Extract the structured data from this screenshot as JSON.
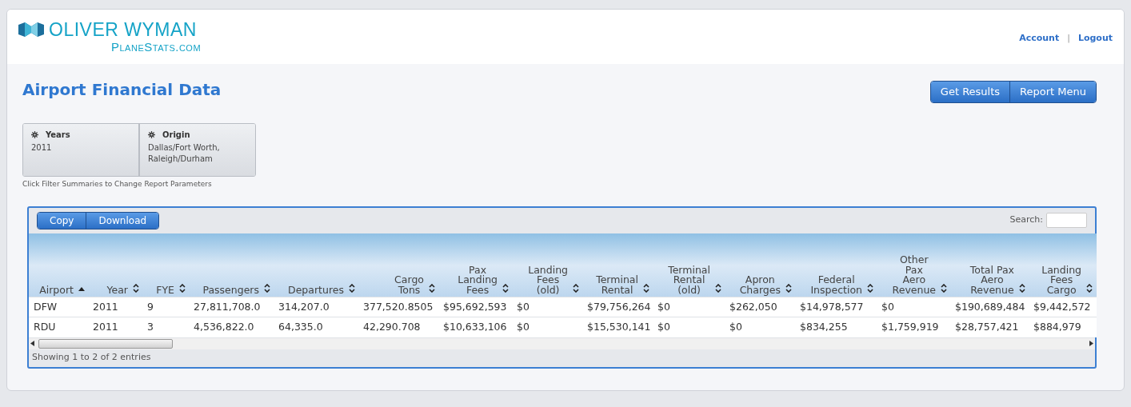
{
  "logo": {
    "brand": "OLIVER WYMAN",
    "site": "PlaneStats.com"
  },
  "user_links": [
    "Account",
    "Logout"
  ],
  "link_separator": "|",
  "page_title": "Airport Financial Data",
  "actions": [
    "Get Results",
    "Report Menu"
  ],
  "filters": [
    {
      "label": "Years",
      "lines": [
        "2011"
      ]
    },
    {
      "label": "Origin",
      "lines": [
        "Dallas/Fort Worth,",
        "Raleigh/Durham"
      ]
    }
  ],
  "filter_hint": "Click Filter Summaries to Change Report Parameters",
  "table_buttons": [
    "Copy",
    "Download"
  ],
  "search": {
    "label": "Search:"
  },
  "table": {
    "columns": [
      {
        "lines": [
          "Airport"
        ],
        "sorted": true
      },
      {
        "lines": [
          "Year"
        ],
        "sorted": false
      },
      {
        "lines": [
          "FYE"
        ],
        "sorted": false
      },
      {
        "lines": [
          "Passengers"
        ],
        "sorted": false
      },
      {
        "lines": [
          "Departures"
        ],
        "sorted": false
      },
      {
        "lines": [
          "Cargo",
          "Tons"
        ],
        "sorted": false
      },
      {
        "lines": [
          "Pax",
          "Landing",
          "Fees"
        ],
        "sorted": false
      },
      {
        "lines": [
          "Landing",
          "Fees",
          "(old)"
        ],
        "sorted": false
      },
      {
        "lines": [
          "Terminal",
          "Rental"
        ],
        "sorted": false
      },
      {
        "lines": [
          "Terminal",
          "Rental",
          "(old)"
        ],
        "sorted": false
      },
      {
        "lines": [
          "Apron",
          "Charges"
        ],
        "sorted": false
      },
      {
        "lines": [
          "Federal",
          "Inspection"
        ],
        "sorted": false
      },
      {
        "lines": [
          "Other",
          "Pax",
          "Aero",
          "Revenue"
        ],
        "sorted": false
      },
      {
        "lines": [
          "Total Pax",
          "Aero",
          "Revenue"
        ],
        "sorted": false
      },
      {
        "lines": [
          "Landing",
          "Fees",
          "Cargo"
        ],
        "sorted": false
      }
    ],
    "rows": [
      [
        "DFW",
        "2011",
        "9",
        "27,811,708.0",
        "314,207.0",
        "377,520.8505",
        "$95,692,593",
        "$0",
        "$79,756,264",
        "$0",
        "$262,050",
        "$14,978,577",
        "$0",
        "$190,689,484",
        "$9,442,572"
      ],
      [
        "RDU",
        "2011",
        "3",
        "4,536,822.0",
        "64,335.0",
        "42,290.708",
        "$10,633,106",
        "$0",
        "$15,530,141",
        "$0",
        "$0",
        "$834,255",
        "$1,759,919",
        "$28,757,421",
        "$884,979"
      ]
    ]
  },
  "footer": "Showing 1 to 2 of 2 entries"
}
